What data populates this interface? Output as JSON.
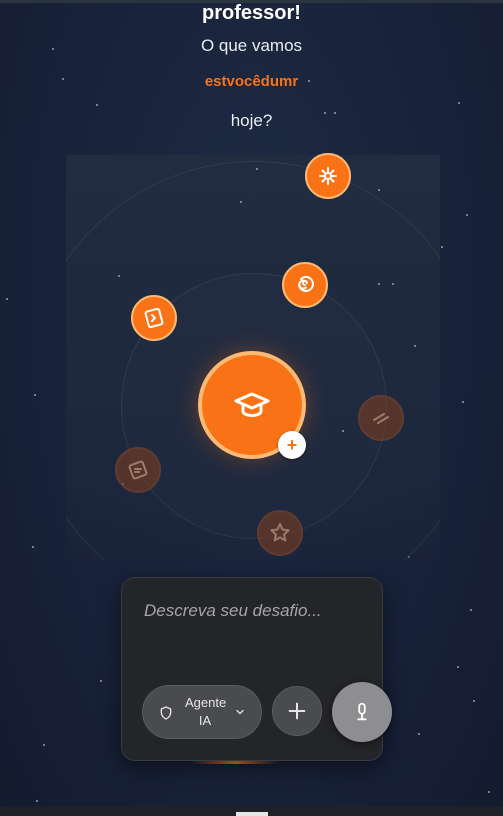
{
  "greeting": {
    "title": "professor!",
    "question": "O que vamos",
    "highlight": "estvocêdumr",
    "end": "hoje?"
  },
  "orbit": {
    "hub_icon": "graduation-cap-icon",
    "hub_badge": "+",
    "nodes": [
      {
        "icon": "sparkle-icon",
        "state": "active"
      },
      {
        "icon": "spiral-icon",
        "state": "active"
      },
      {
        "icon": "notebook-icon",
        "state": "active"
      },
      {
        "icon": "pencil-icon",
        "state": "dimmed"
      },
      {
        "icon": "document-icon",
        "state": "dimmed"
      },
      {
        "icon": "star-icon",
        "state": "dimmed"
      }
    ]
  },
  "composer": {
    "placeholder": "Descreva seu desafio...",
    "value": "",
    "agent_label_line1": "Agente",
    "agent_label_line2": "IA",
    "agent_icon": "shield-icon",
    "plus_icon": "plus-icon",
    "mic_icon": "microphone-icon"
  },
  "colors": {
    "accent": "#f97316",
    "accent_light": "#fdba74",
    "background": "#18223a",
    "composer_bg": "#242528"
  }
}
